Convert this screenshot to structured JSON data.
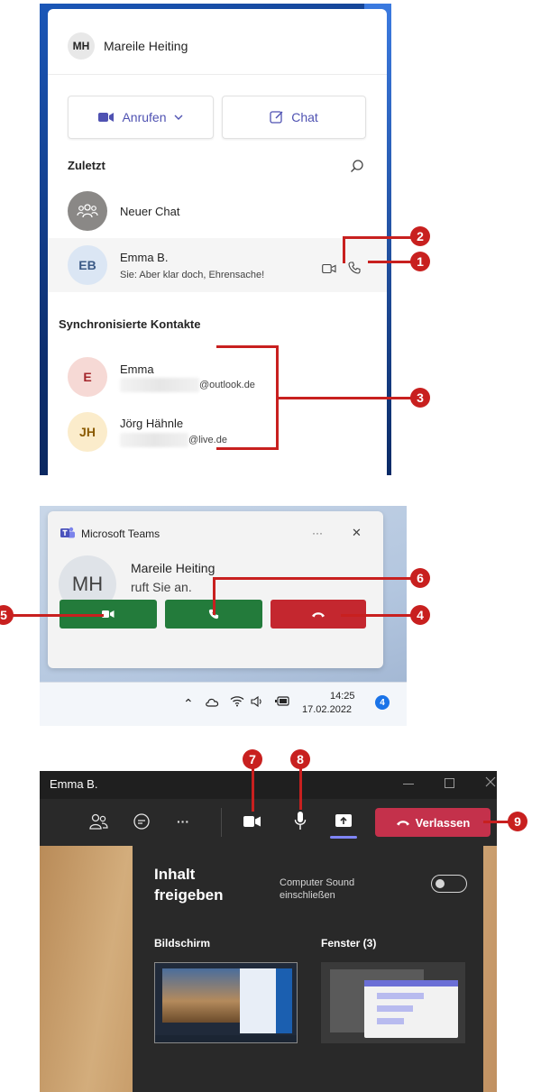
{
  "chat_flyout": {
    "user": {
      "initials": "MH",
      "name": "Mareile Heiting"
    },
    "call_button": "Anrufen",
    "chat_button": "Chat",
    "recent_heading": "Zuletzt",
    "new_chat": "Neuer Chat",
    "recent_contact": {
      "initials": "EB",
      "name": "Emma B.",
      "preview": "Sie: Aber klar doch, Ehrensache!"
    },
    "synced_heading": "Synchronisierte Kontakte",
    "contacts": [
      {
        "initials": "E",
        "name": "Emma",
        "email": "@outlook.de"
      },
      {
        "initials": "JH",
        "name": "Jörg Hähnle",
        "email": "@live.de"
      }
    ]
  },
  "incoming_call": {
    "app_name": "Microsoft Teams",
    "more": "···",
    "close": "✕",
    "caller_initials": "MH",
    "caller_name": "Mareile Heiting",
    "status": "ruft Sie an."
  },
  "taskbar": {
    "time": "14:25",
    "date": "17.02.2022",
    "badge": "4"
  },
  "meeting": {
    "title": "Emma B.",
    "more": "···",
    "leave_button": "Verlassen",
    "share_panel": {
      "title_line1": "Inhalt",
      "title_line2": "freigeben",
      "sound_label_line1": "Computer Sound",
      "sound_label_line2": "einschließen",
      "screen_label": "Bildschirm",
      "window_label": "Fenster (3)"
    }
  },
  "callouts": [
    "1",
    "2",
    "3",
    "4",
    "5",
    "6",
    "7",
    "8",
    "9"
  ],
  "colors": {
    "accent": "#4f52b2",
    "callout": "#c8201f",
    "accept": "#237b3b",
    "decline": "#c4272f",
    "leave": "#c4314b"
  }
}
